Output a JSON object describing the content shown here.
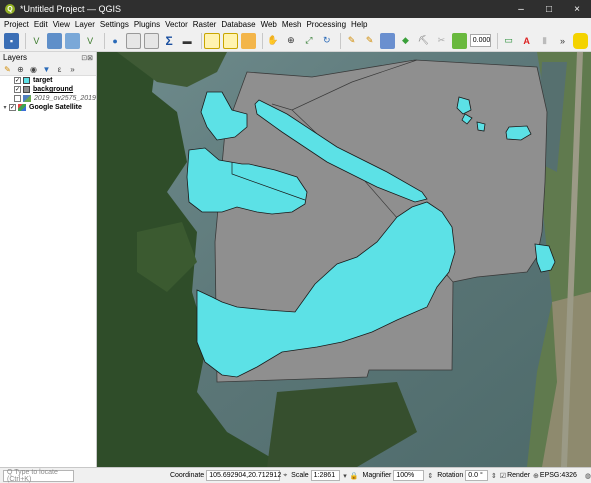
{
  "window": {
    "title": "*Untitled Project — QGIS",
    "app_icon_letter": "Q",
    "controls": [
      "–",
      "□",
      "×"
    ]
  },
  "menu": [
    "Project",
    "Edit",
    "View",
    "Layer",
    "Settings",
    "Plugins",
    "Vector",
    "Raster",
    "Database",
    "Web",
    "Mesh",
    "Processing",
    "Help"
  ],
  "toolbar": {
    "opacity_value": "0.000",
    "overflow_icon": "»"
  },
  "layers_panel": {
    "title": "Layers",
    "items": [
      {
        "label": "target",
        "checked": "✓",
        "style": "bold",
        "swatch_color": "#5ce1e6"
      },
      {
        "label": "background",
        "checked": "✓",
        "style": "underline",
        "swatch_color": "#8f8f8f"
      },
      {
        "label": "2019_ov2575_2019",
        "checked": "",
        "style": "italic"
      },
      {
        "label": "Google Satellite",
        "checked": "✓",
        "style": "bold"
      }
    ]
  },
  "status": {
    "locate_placeholder": "Q  Type to locate (Ctrl+K)",
    "coordinate_label": "Coordinate",
    "coordinate_value": "105.692904,20.712912",
    "scale_label": "Scale",
    "scale_value": "1:2861",
    "magnifier_label": "Magnifier",
    "magnifier_value": "100%",
    "rotation_label": "Rotation",
    "rotation_value": "0.0 °",
    "render_label": "Render",
    "crs_label": "EPSG:4326"
  },
  "colors": {
    "target_fill": "#5ce1e6",
    "background_fill": "#8f8f8f",
    "water": "#5f7b7c",
    "vegetation": "#2a4a24"
  }
}
